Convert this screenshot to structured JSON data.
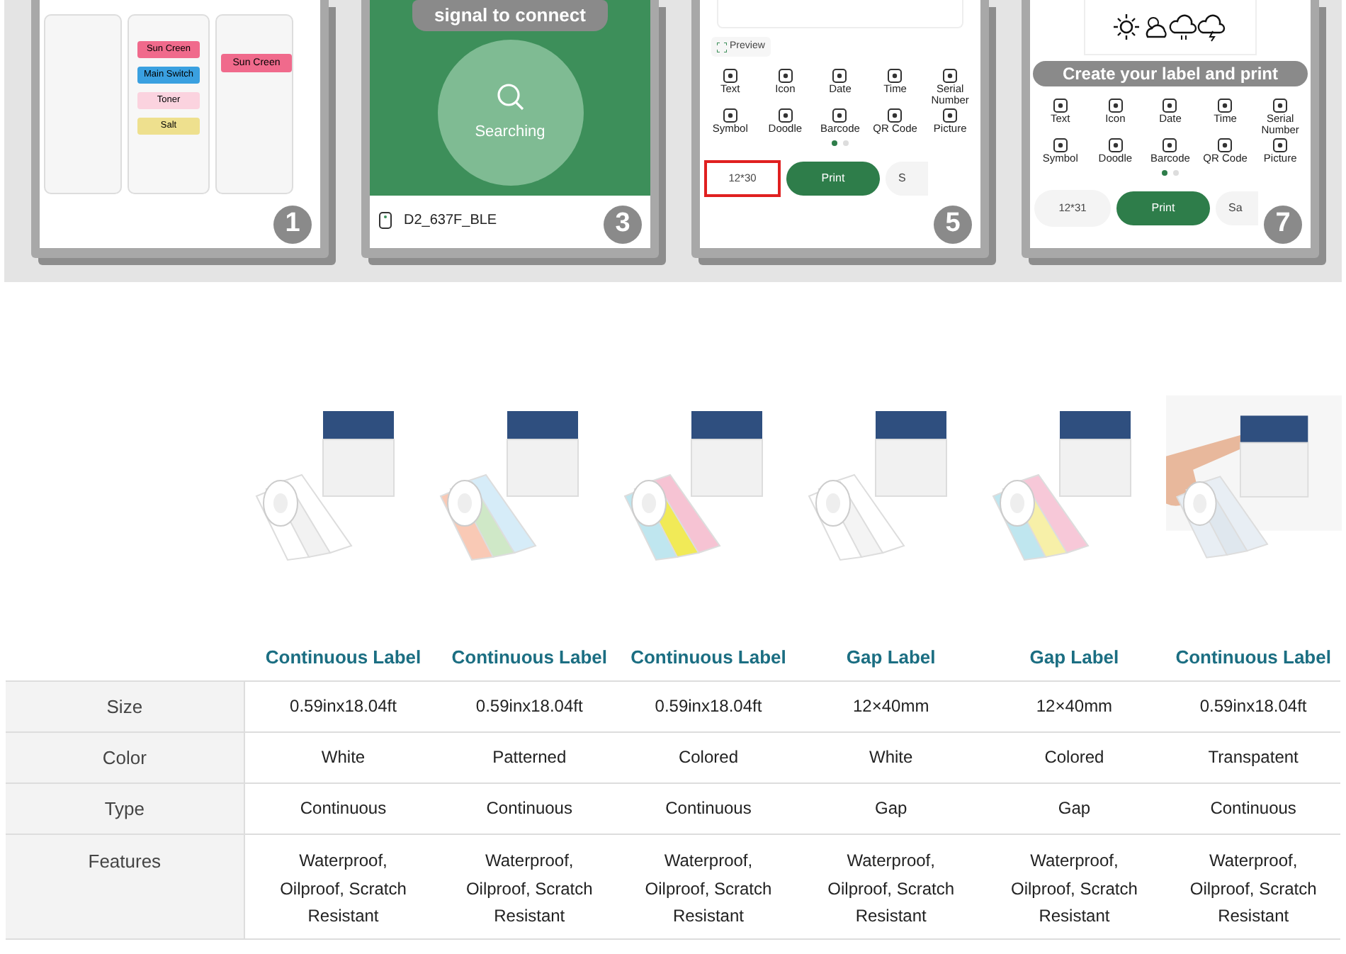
{
  "panels": [
    {
      "kind": "templates",
      "number": "1",
      "labels": [
        "Sun Creen",
        "Main Switch",
        "Toner",
        "Salt"
      ],
      "canvas_label": "Sun Creen"
    },
    {
      "kind": "search",
      "number": "3",
      "banner": "signal to connect",
      "status": "Searching",
      "device": "D2_637F_BLE"
    },
    {
      "kind": "editor",
      "number": "5",
      "preview": "Preview",
      "tools": [
        "Text",
        "Icon",
        "Date",
        "Time",
        "Serial Number",
        "Symbol",
        "Doodle",
        "Barcode",
        "QR Code",
        "Picture"
      ],
      "pages": [
        {
          "selected": true
        },
        {
          "selected": false
        }
      ],
      "size": "12*30",
      "highlighted": true,
      "print": "Print",
      "save": "S"
    },
    {
      "kind": "editor",
      "number": "7",
      "banner": "Create your label and print",
      "tools": [
        "Text",
        "Icon",
        "Date",
        "Time",
        "Serial Number",
        "Symbol",
        "Doodle",
        "Barcode",
        "QR Code",
        "Picture"
      ],
      "pages": [
        {
          "selected": true
        },
        {
          "selected": false
        }
      ],
      "size": "12*31",
      "highlighted": false,
      "print": "Print",
      "save": "Sa"
    }
  ],
  "table": {
    "columns": [
      "Continuous Label",
      "Continuous Label",
      "Continuous Label",
      "Gap Label",
      "Gap Label",
      "Continuous Label"
    ],
    "rows": [
      {
        "label": "Size",
        "cells": [
          "0.59inx18.04ft",
          "0.59inx18.04ft",
          "0.59inx18.04ft",
          "12×40mm",
          "12×40mm",
          "0.59inx18.04ft"
        ]
      },
      {
        "label": "Color",
        "cells": [
          "White",
          "Patterned",
          "Colored",
          "White",
          "Colored",
          "Transpatent"
        ]
      },
      {
        "label": "Type",
        "cells": [
          "Continuous",
          "Continuous",
          "Continuous",
          "Gap",
          "Gap",
          "Continuous"
        ]
      },
      {
        "label": "Features",
        "cells": [
          "Waterproof, Oilproof, Scratch Resistant",
          "Waterproof, Oilproof, Scratch Resistant",
          "Waterproof, Oilproof, Scratch Resistant",
          "Waterproof, Oilproof, Scratch Resistant",
          "Waterproof, Oilproof, Scratch Resistant",
          "Waterproof, Oilproof, Scratch Resistant"
        ]
      }
    ]
  }
}
